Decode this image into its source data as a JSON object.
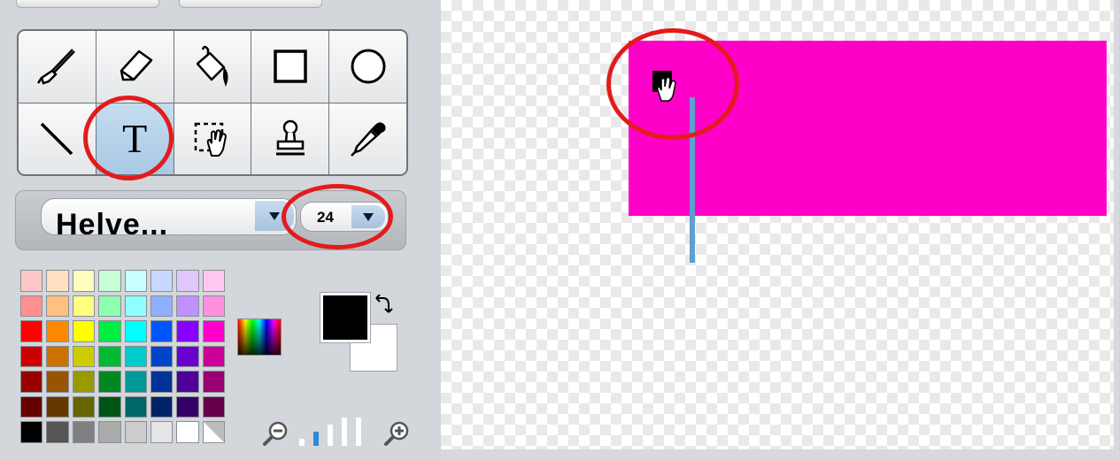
{
  "tools": [
    {
      "id": "brush",
      "icon": "brush-icon",
      "selected": false
    },
    {
      "id": "eraser",
      "icon": "eraser-icon",
      "selected": false
    },
    {
      "id": "fill",
      "icon": "paint-bucket-icon",
      "selected": false
    },
    {
      "id": "rectangle",
      "icon": "rectangle-icon",
      "selected": false
    },
    {
      "id": "ellipse",
      "icon": "ellipse-icon",
      "selected": false
    },
    {
      "id": "line",
      "icon": "line-icon",
      "selected": false
    },
    {
      "id": "text",
      "icon": "text-icon",
      "selected": true,
      "label": "T"
    },
    {
      "id": "select",
      "icon": "select-hand-icon",
      "selected": false
    },
    {
      "id": "stamp",
      "icon": "stamp-icon",
      "selected": false
    },
    {
      "id": "eyedropper",
      "icon": "eyedropper-icon",
      "selected": false
    }
  ],
  "font": {
    "name": "Helve...",
    "size": "24"
  },
  "palette": [
    [
      "#ffc8c8",
      "#ffe0c0",
      "#ffffc0",
      "#c8ffd8",
      "#c8ffff",
      "#c8d8ff",
      "#e0c8ff",
      "#ffc8f0"
    ],
    [
      "#ff9090",
      "#ffc080",
      "#ffff80",
      "#90ffb0",
      "#90ffff",
      "#90b0ff",
      "#c090ff",
      "#ff90e0"
    ],
    [
      "#ff0000",
      "#ff8800",
      "#ffff00",
      "#00ee44",
      "#00ffff",
      "#0055ff",
      "#8800ff",
      "#ff00cc"
    ],
    [
      "#cc0000",
      "#cc7000",
      "#cccc00",
      "#00bb33",
      "#00cccc",
      "#0044cc",
      "#6a00cc",
      "#cc0099"
    ],
    [
      "#990000",
      "#995400",
      "#999900",
      "#008822",
      "#009999",
      "#003399",
      "#4f0099",
      "#990073"
    ],
    [
      "#660000",
      "#663800",
      "#666600",
      "#005516",
      "#006666",
      "#002266",
      "#350066",
      "#66004c"
    ],
    [
      "#000000",
      "#555555",
      "#808080",
      "#aaaaaa",
      "#cccccc",
      "#e5e5e5",
      "#ffffff",
      "empty"
    ]
  ],
  "colors": {
    "foreground": "#000000",
    "background": "#ffffff",
    "canvas_rect": "#ff00c8",
    "annotation": "#e31b1b",
    "accent": "#2f89d6"
  },
  "zoom": {
    "level_index": 1,
    "levels": 4
  }
}
